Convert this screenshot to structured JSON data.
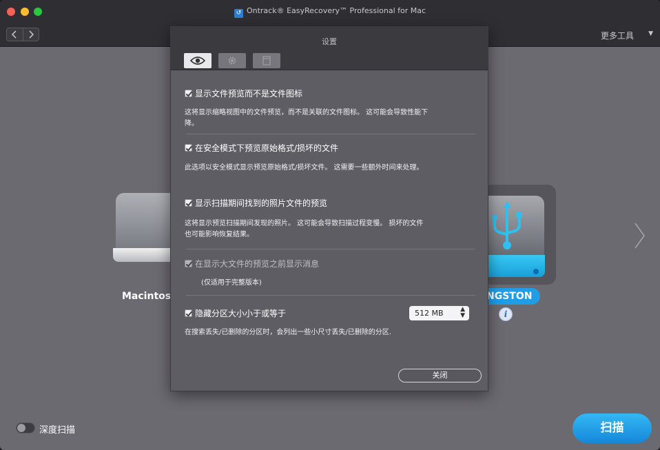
{
  "window": {
    "title": "Ontrack® EasyRecovery™ Professional for Mac"
  },
  "toolbar": {
    "back_icon": "chevron-left-icon",
    "forward_icon": "chevron-right-icon",
    "more_tools": "更多工具",
    "more_icon": "triangle-down-icon"
  },
  "drives": {
    "left_label": "Macintosh",
    "usb_label": "NGSTON"
  },
  "bottom": {
    "deep_scan_label": "深度扫描",
    "deep_scan_on": false,
    "scan_button": "扫描"
  },
  "settings": {
    "title": "设置",
    "tabs": [
      {
        "icon": "eye-icon",
        "active": true
      },
      {
        "icon": "gear-icon",
        "active": false
      },
      {
        "icon": "document-icon",
        "active": false
      }
    ],
    "options": [
      {
        "label": "显示文件预览而不是文件图标",
        "checked": true,
        "desc_lines": [
          "这将显示缩略视图中的文件预览，而不是关联的文件图标。 这可能会导致性能下",
          "降。"
        ]
      },
      {
        "label": "在安全模式下预览原始格式/损坏的文件",
        "checked": true,
        "desc_lines": [
          "此选项以安全模式显示预览原始格式/损坏文件。 这需要一些额外时间来处理。"
        ]
      },
      {
        "label": "显示扫描期间找到的照片文件的预览",
        "checked": true,
        "desc_lines": [
          "这将显示预览扫描期间发现的照片。  这可能会导致扫描过程变慢。  损坏的文件",
          "也可能影响恢复结果。"
        ]
      },
      {
        "label": "在显示大文件的预览之前显示消息",
        "checked": true,
        "disabled": true,
        "desc_lines": [
          "(仅适用于完整版本)"
        ]
      },
      {
        "label": "隐藏分区大小小于或等于",
        "checked": true,
        "desc_lines": [
          "在搜索丢失/已删除的分区时，会列出一些小尺寸丢失/已删除的分区."
        ]
      }
    ],
    "partition_size": "512 MB",
    "close_button": "关闭"
  }
}
